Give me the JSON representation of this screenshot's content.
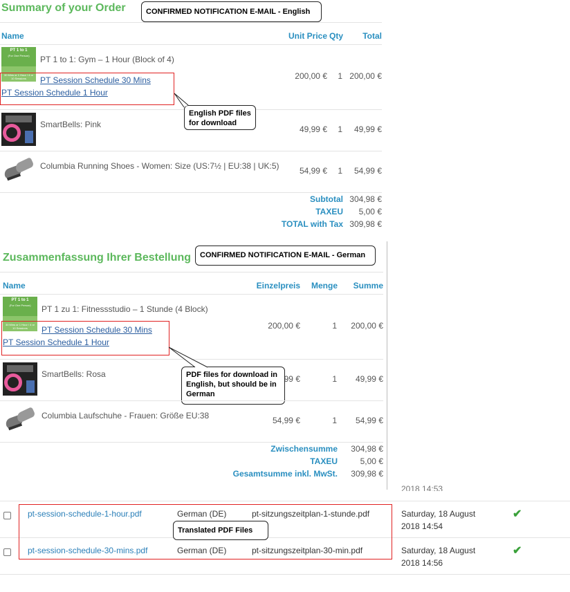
{
  "english": {
    "title": "Summary of your Order",
    "callout": "CONFIRMED NOTIFICATION E-MAIL - English",
    "headers": {
      "name": "Name",
      "unit_price": "Unit Price",
      "qty": "Qty",
      "total": "Total"
    },
    "items": [
      {
        "name": "PT 1 to 1: Gym – 1 Hour (Block of 4)",
        "price": "200,00 €",
        "qty": "1",
        "total": "200,00 €",
        "thumb_icon": "pt-1to1-thumbnail"
      },
      {
        "name": "SmartBells: Pink",
        "price": "49,99 €",
        "qty": "1",
        "total": "49,99 €",
        "thumb_icon": "smartbells-thumbnail"
      },
      {
        "name": "Columbia Running Shoes - Women: Size (US:7½ | EU:38 | UK:5)",
        "price": "54,99 €",
        "qty": "1",
        "total": "54,99 €",
        "thumb_icon": "shoes-thumbnail"
      }
    ],
    "downloads": [
      "PT Session Schedule 30 Mins",
      "PT Session Schedule 1 Hour"
    ],
    "download_callout": "English PDF files for download",
    "thumb_text": {
      "top": "PT 1 to 1",
      "sub": "(For One Person)",
      "bottom": "30 Mins or 1 Hour / 4 or 10 Sessions"
    },
    "totals": [
      {
        "label": "Subtotal",
        "value": "304,98 €"
      },
      {
        "label": "TAXEU",
        "value": "5,00 €"
      },
      {
        "label": "TOTAL with Tax",
        "value": "309,98 €"
      }
    ]
  },
  "german": {
    "title": "Zusammenfassung Ihrer Bestellung",
    "callout": "CONFIRMED NOTIFICATION E-MAIL - German",
    "headers": {
      "name": "Name",
      "unit_price": "Einzelpreis",
      "qty": "Menge",
      "total": "Summe"
    },
    "items": [
      {
        "name": "PT 1 zu 1: Fitnessstudio – 1 Stunde (4 Block)",
        "price": "200,00 €",
        "qty": "1",
        "total": "200,00 €"
      },
      {
        "name": "SmartBells: Rosa",
        "price": "49,99 €",
        "qty": "1",
        "total": "49,99 €"
      },
      {
        "name": "Columbia Laufschuhe - Frauen: Größe EU:38",
        "price": "54,99 €",
        "qty": "1",
        "total": "54,99 €"
      }
    ],
    "downloads": [
      "PT Session Schedule 30 Mins",
      "PT Session Schedule 1 Hour"
    ],
    "download_callout": "PDF files for download in English, but should be in German",
    "thumb_text": {
      "top": "PT 1 to 1",
      "sub": "(For One Person)",
      "bottom": "30 Mins or 1 Hour / 4 or 10 Sessions"
    },
    "totals": [
      {
        "label": "Zwischensumme",
        "value": "304,98 €"
      },
      {
        "label": "TAXEU",
        "value": "5,00 €"
      },
      {
        "label": "Gesamtsumme inkl. MwSt.",
        "value": "309,98 €"
      }
    ]
  },
  "files": {
    "callout": "Translated PDF Files",
    "partial_timestamp": "2018 14:53",
    "rows": [
      {
        "original": "pt-session-schedule-1-hour.pdf",
        "language": "German (DE)",
        "translated": "pt-sitzungszeitplan-1-stunde.pdf",
        "date": "Saturday, 18 August",
        "time": "2018 14:54"
      },
      {
        "original": "pt-session-schedule-30-mins.pdf",
        "language": "German (DE)",
        "translated": "pt-sitzungszeitplan-30-min.pdf",
        "date": "Saturday, 18 August",
        "time": "2018 14:56"
      }
    ]
  },
  "colors": {
    "title_green": "#5cb85c",
    "header_blue": "#2a8fc0",
    "link_blue": "#2a5d9f",
    "highlight_red": "#e02020",
    "check_green": "#3aa13a"
  }
}
